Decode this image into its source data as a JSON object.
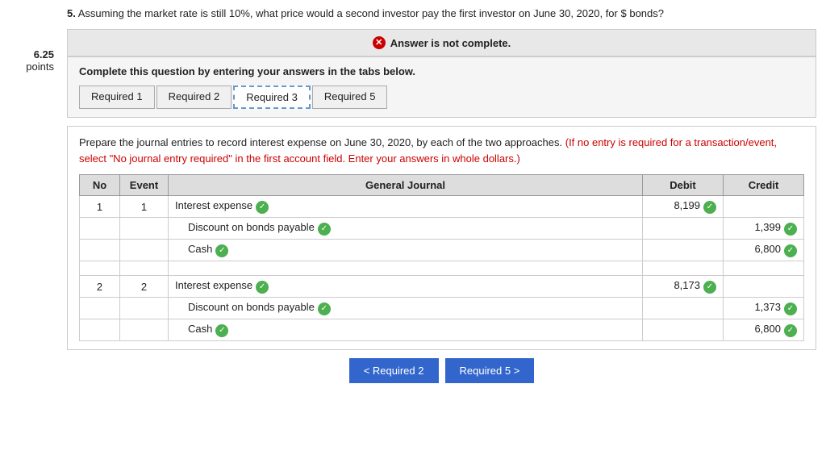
{
  "sidebar": {
    "points_label": "6.25",
    "points_text": "points"
  },
  "question": {
    "number": "5.",
    "text": "Assuming the market rate is still 10%, what price would a second investor pay the first investor on June 30, 2020, for $",
    "text2": "bonds?"
  },
  "banner": {
    "icon": "✕",
    "text": "Answer is not complete."
  },
  "complete_box": {
    "instruction": "Complete this question by entering your answers in the tabs below."
  },
  "tabs": [
    {
      "label": "Required 1",
      "active": false
    },
    {
      "label": "Required 2",
      "active": false
    },
    {
      "label": "Required 3",
      "active": true
    },
    {
      "label": "Required 5",
      "active": false
    }
  ],
  "instructions": {
    "main": "Prepare the journal entries to record interest expense on June 30, 2020, by each of the two approaches.",
    "red": "(If no entry is required for a transaction/event, select \"No journal entry required\" in the first account field. Enter your answers in whole dollars.)"
  },
  "table": {
    "headers": [
      "No",
      "Event",
      "General Journal",
      "Debit",
      "Credit"
    ],
    "rows": [
      {
        "no": "1",
        "event": "1",
        "account": "Interest expense",
        "check": true,
        "debit": "8,199",
        "debit_check": true,
        "credit": ""
      },
      {
        "no": "",
        "event": "",
        "account": "Discount on bonds payable",
        "check": true,
        "debit": "",
        "debit_check": false,
        "credit": "1,399",
        "credit_check": true
      },
      {
        "no": "",
        "event": "",
        "account": "Cash",
        "check": true,
        "debit": "",
        "debit_check": false,
        "credit": "6,800",
        "credit_check": true
      },
      {
        "no": "",
        "event": "",
        "account": "",
        "check": false,
        "debit": "",
        "debit_check": false,
        "credit": ""
      },
      {
        "no": "2",
        "event": "2",
        "account": "Interest expense",
        "check": true,
        "debit": "8,173",
        "debit_check": true,
        "credit": ""
      },
      {
        "no": "",
        "event": "",
        "account": "Discount on bonds payable",
        "check": true,
        "debit": "",
        "debit_check": false,
        "credit": "1,373",
        "credit_check": true
      },
      {
        "no": "",
        "event": "",
        "account": "Cash",
        "check": true,
        "debit": "",
        "debit_check": false,
        "credit": "6,800",
        "credit_check": true
      }
    ]
  },
  "bottom_nav": {
    "prev_label": "< Required 2",
    "next_label": "Required 5 >"
  }
}
